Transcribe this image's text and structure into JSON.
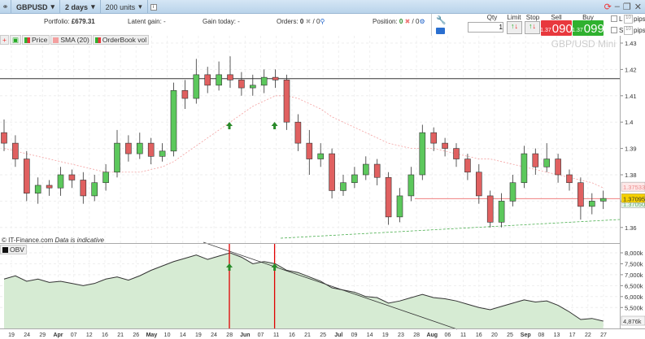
{
  "toolbar": {
    "symbol": "GBPUSD",
    "period": "2 days",
    "units": "200 units",
    "info_icon": "info-icon",
    "link_icon": "link-icon"
  },
  "info": {
    "portfolio_label": "Portfolio:",
    "portfolio_value": "£679.31",
    "latent_label": "Latent gain:",
    "latent_value": "-",
    "gain_today_label": "Gain today:",
    "gain_today_value": "-",
    "orders_label": "Orders:",
    "orders_value": "0",
    "orders_sep": "/ 0",
    "position_label": "Position:",
    "position_value": "0",
    "position_sep": "/ 0"
  },
  "trade": {
    "qty_label": "Qty",
    "qty_value": "1",
    "limit_label": "Limit",
    "stop_label": "Stop",
    "sell_label": "Sell",
    "sell_big": "1.37",
    "sell_small": "090",
    "buy_label": "Buy",
    "buy_big": "1.37",
    "buy_small": "099",
    "l_label": "L",
    "s_label": "S",
    "l_pips": "10",
    "s_pips": "10",
    "pips_label": "pips",
    "colors": {
      "sell": "#e8383d",
      "buy": "#2fb12f"
    }
  },
  "legend": {
    "price": "Price",
    "sma": "SMA (20)",
    "orderbook": "OrderBook vol",
    "obv": "OBV"
  },
  "watermark": "GBP/USD Mini",
  "footnote": {
    "source": "© IT-Finance.com",
    "note": "Data is indicative"
  },
  "chart_data": {
    "type": "candlestick",
    "price_axis": {
      "ticks": [
        "1.43",
        "1.42",
        "1.41",
        "1.4",
        "1.39",
        "1.38",
        "1.37",
        "1.36"
      ],
      "ylim": [
        1.357,
        1.433
      ]
    },
    "tags": {
      "sma": "1.37533",
      "bid": "1.37095",
      "low": "1.37050"
    },
    "horizontal_line": 1.4165,
    "current_line": 1.37095,
    "ohlc": [
      [
        1.396,
        1.401,
        1.389,
        1.392
      ],
      [
        1.392,
        1.395,
        1.383,
        1.386
      ],
      [
        1.386,
        1.389,
        1.37,
        1.373
      ],
      [
        1.373,
        1.379,
        1.369,
        1.376
      ],
      [
        1.376,
        1.378,
        1.372,
        1.375
      ],
      [
        1.375,
        1.383,
        1.372,
        1.38
      ],
      [
        1.38,
        1.382,
        1.375,
        1.378
      ],
      [
        1.378,
        1.381,
        1.369,
        1.372
      ],
      [
        1.372,
        1.38,
        1.37,
        1.377
      ],
      [
        1.377,
        1.384,
        1.374,
        1.381
      ],
      [
        1.381,
        1.397,
        1.379,
        1.392
      ],
      [
        1.392,
        1.395,
        1.385,
        1.388
      ],
      [
        1.388,
        1.396,
        1.386,
        1.392
      ],
      [
        1.392,
        1.394,
        1.384,
        1.387
      ],
      [
        1.387,
        1.392,
        1.385,
        1.389
      ],
      [
        1.389,
        1.415,
        1.387,
        1.412
      ],
      [
        1.412,
        1.416,
        1.405,
        1.409
      ],
      [
        1.409,
        1.424,
        1.407,
        1.418
      ],
      [
        1.418,
        1.421,
        1.411,
        1.414
      ],
      [
        1.414,
        1.423,
        1.412,
        1.418
      ],
      [
        1.418,
        1.425,
        1.413,
        1.416
      ],
      [
        1.416,
        1.419,
        1.41,
        1.413
      ],
      [
        1.413,
        1.418,
        1.41,
        1.414
      ],
      [
        1.414,
        1.42,
        1.411,
        1.417
      ],
      [
        1.417,
        1.42,
        1.413,
        1.416
      ],
      [
        1.416,
        1.418,
        1.397,
        1.4
      ],
      [
        1.4,
        1.403,
        1.389,
        1.392
      ],
      [
        1.392,
        1.397,
        1.38,
        1.386
      ],
      [
        1.386,
        1.392,
        1.383,
        1.388
      ],
      [
        1.388,
        1.39,
        1.371,
        1.374
      ],
      [
        1.374,
        1.38,
        1.372,
        1.377
      ],
      [
        1.377,
        1.383,
        1.375,
        1.38
      ],
      [
        1.38,
        1.387,
        1.378,
        1.384
      ],
      [
        1.384,
        1.386,
        1.376,
        1.379
      ],
      [
        1.379,
        1.381,
        1.361,
        1.364
      ],
      [
        1.364,
        1.375,
        1.362,
        1.372
      ],
      [
        1.372,
        1.383,
        1.37,
        1.38
      ],
      [
        1.38,
        1.399,
        1.378,
        1.396
      ],
      [
        1.396,
        1.398,
        1.389,
        1.392
      ],
      [
        1.392,
        1.394,
        1.387,
        1.39
      ],
      [
        1.39,
        1.392,
        1.383,
        1.386
      ],
      [
        1.386,
        1.388,
        1.378,
        1.381
      ],
      [
        1.381,
        1.384,
        1.369,
        1.372
      ],
      [
        1.372,
        1.374,
        1.36,
        1.362
      ],
      [
        1.362,
        1.373,
        1.36,
        1.37
      ],
      [
        1.37,
        1.38,
        1.368,
        1.377
      ],
      [
        1.377,
        1.391,
        1.375,
        1.388
      ],
      [
        1.388,
        1.39,
        1.38,
        1.383
      ],
      [
        1.383,
        1.392,
        1.381,
        1.386
      ],
      [
        1.386,
        1.388,
        1.377,
        1.38
      ],
      [
        1.38,
        1.382,
        1.374,
        1.377
      ],
      [
        1.377,
        1.379,
        1.363,
        1.368
      ],
      [
        1.368,
        1.373,
        1.365,
        1.37
      ],
      [
        1.37,
        1.374,
        1.367,
        1.371
      ]
    ],
    "sma": [
      1.39,
      1.389,
      1.388,
      1.387,
      1.386,
      1.385,
      1.384,
      1.383,
      1.382,
      1.381,
      1.381,
      1.381,
      1.381,
      1.382,
      1.383,
      1.385,
      1.388,
      1.391,
      1.394,
      1.397,
      1.4,
      1.403,
      1.406,
      1.408,
      1.41,
      1.41,
      1.409,
      1.407,
      1.405,
      1.402,
      1.4,
      1.398,
      1.396,
      1.394,
      1.392,
      1.391,
      1.39,
      1.39,
      1.39,
      1.389,
      1.388,
      1.387,
      1.386,
      1.386,
      1.385,
      1.384,
      1.383,
      1.382,
      1.381,
      1.38,
      1.379,
      1.378,
      1.377,
      1.375
    ],
    "obv": {
      "axis_ticks": [
        "8,000k",
        "7,500k",
        "7,000k",
        "6,500k",
        "6,000k",
        "5,500k"
      ],
      "current": "4,876k",
      "values": [
        6800,
        6950,
        6700,
        6800,
        6650,
        6700,
        6600,
        6500,
        6600,
        6800,
        6900,
        6750,
        6950,
        7200,
        7400,
        7600,
        7750,
        7900,
        7700,
        7850,
        8000,
        7800,
        7500,
        7600,
        7500,
        7200,
        7100,
        6900,
        6700,
        6400,
        6300,
        6200,
        6000,
        5950,
        5700,
        5800,
        5950,
        6100,
        5950,
        5900,
        5800,
        5650,
        5500,
        5400,
        5550,
        5700,
        5850,
        5750,
        5800,
        5600,
        5300,
        4950,
        5000,
        4876
      ]
    },
    "x_labels": [
      "19",
      "24",
      "29",
      "Apr",
      "07",
      "12",
      "16",
      "21",
      "26",
      "May",
      "10",
      "14",
      "19",
      "24",
      "28",
      "Jun",
      "07",
      "11",
      "16",
      "21",
      "25",
      "Jul",
      "09",
      "14",
      "19",
      "23",
      "28",
      "Aug",
      "06",
      "11",
      "16",
      "20",
      "25",
      "Sep",
      "08",
      "13",
      "17",
      "22",
      "27"
    ],
    "month_labels": [
      "Apr",
      "May",
      "Jun",
      "Jul",
      "Aug",
      "Sep"
    ],
    "markers": {
      "arrow_candles": [
        20,
        24
      ],
      "colors": {
        "up": "#2a8a2a",
        "down": "#e05050",
        "obv_fill": "#d6ebd3",
        "vline": "#e00000"
      }
    }
  }
}
